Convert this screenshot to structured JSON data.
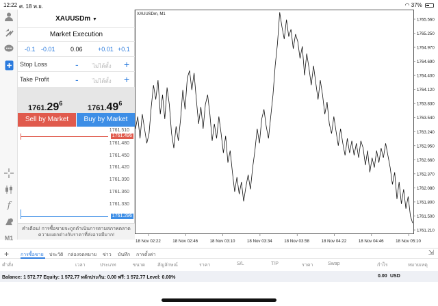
{
  "status": {
    "time": "12:22",
    "date": "ศ. 18 พ.ย.",
    "battery": "37%"
  },
  "panel": {
    "symbol": "XAUUSDm",
    "execution": "Market Execution",
    "lot_buttons": [
      "-0.1",
      "-0.01",
      "0.06",
      "+0.01",
      "+0.1"
    ],
    "stop_loss_label": "Stop Loss",
    "take_profit_label": "Take Profit",
    "not_set": "ไม่ได้ตั้ง",
    "minus": "-",
    "plus": "+",
    "bid_main": "1761.",
    "bid_big": "29",
    "bid_sup": "6",
    "ask_main": "1761.",
    "ask_big": "49",
    "ask_sup": "6",
    "sell_label": "Sell by Market",
    "buy_label": "Buy by Market",
    "depth_levels": [
      "1761.510",
      "1761.480",
      "1761.450",
      "1761.420",
      "1761.390",
      "1761.360",
      "1761.330"
    ],
    "depth_ask_tag": "1761.496",
    "depth_bid_tag": "1761.296",
    "warning": "คำเตือน! การซื้อขายจะถูกดำเนินการตามสภาพตลาด ความแตกต่างกับราคาที่ส่งอาจมีมาก!"
  },
  "chart_data": {
    "type": "line",
    "title": "XAUUSDm, M1",
    "y_ticks": [
      "1765.560",
      "1765.250",
      "1764.970",
      "1764.690",
      "1764.400",
      "1764.120",
      "1763.830",
      "1763.540",
      "1763.240",
      "1762.950",
      "1762.660",
      "1762.370",
      "1762.080",
      "1761.800",
      "1761.500",
      "1761.210"
    ],
    "x_ticks": [
      "18 Nov 02:22",
      "18 Nov 02:46",
      "18 Nov 03:10",
      "18 Nov 03:34",
      "18 Nov 03:58",
      "18 Nov 04:22",
      "18 Nov 04:46",
      "18 Nov 05:10"
    ],
    "ylim": [
      1761.21,
      1765.56
    ],
    "series": [
      {
        "values": [
          1763.3,
          1763.55,
          1763.1,
          1763.6,
          1763.3,
          1763.0,
          1763.2,
          1763.75,
          1764.2,
          1763.9,
          1764.3,
          1763.6,
          1764.0,
          1763.5,
          1764.15,
          1763.8,
          1763.2,
          1762.9,
          1763.35,
          1763.05,
          1763.5,
          1764.1,
          1763.7,
          1764.35,
          1764.5,
          1764.1,
          1764.45,
          1763.9,
          1763.4,
          1763.75,
          1763.3,
          1763.8,
          1764.0,
          1763.6,
          1763.05,
          1763.4,
          1763.1,
          1763.55,
          1763.2,
          1762.8,
          1763.15,
          1762.6,
          1762.85,
          1762.4,
          1762.0,
          1762.3,
          1761.95,
          1762.2,
          1761.8,
          1762.1,
          1762.35,
          1762.05,
          1762.5,
          1762.85,
          1763.3,
          1763.0,
          1763.5,
          1763.7,
          1763.35,
          1763.1,
          1763.55,
          1764.0,
          1764.6,
          1765.05,
          1765.7,
          1765.4,
          1765.15,
          1765.55,
          1765.2,
          1765.35,
          1764.95,
          1765.25,
          1765.1,
          1764.75,
          1765.0,
          1764.4,
          1764.85,
          1764.55,
          1764.2,
          1764.6,
          1764.25,
          1763.9,
          1764.3,
          1764.0,
          1763.6,
          1763.85,
          1763.4,
          1763.2,
          1763.55,
          1763.25,
          1762.95,
          1763.3,
          1763.0,
          1762.75,
          1763.1,
          1762.8,
          1763.05,
          1762.75,
          1763.0,
          1762.7,
          1763.05,
          1762.9,
          1762.55,
          1762.85,
          1762.4,
          1762.7,
          1762.5,
          1762.85,
          1762.6,
          1762.9,
          1762.7,
          1763.0,
          1762.75,
          1762.5,
          1762.15,
          1762.4,
          1761.85,
          1762.2,
          1761.75,
          1762.05,
          1761.65,
          1761.9,
          1761.5,
          1761.35
        ]
      }
    ],
    "grid": false
  },
  "tabs": [
    "การซื้อขาย",
    "ประวัติ",
    "กล่องจดหมาย",
    "ข่าว",
    "บันทึก",
    "การตั้งค่า"
  ],
  "table_headers": [
    "คำสั่ง",
    "เวลา",
    "ประเภท",
    "ขนาด",
    "สัญลักษณ์",
    "ราคา",
    "S/L",
    "T/P",
    "ราคา",
    "Swap",
    "กำไร",
    "หมายเหตุ"
  ],
  "balance": {
    "text": "Balance: 1 572.77 Equity: 1 572.77 หลักประกัน: 0.00 ฟรี: 1 572.77 Level: 0.00%",
    "profit": "0.00",
    "currency": "USD"
  }
}
